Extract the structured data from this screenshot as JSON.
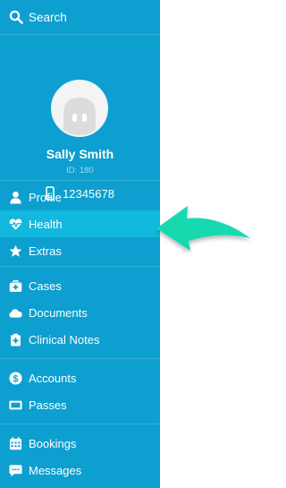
{
  "search": {
    "label": "Search",
    "icon": "search-icon"
  },
  "user": {
    "name": "Sally Smith",
    "id": "ID: 180",
    "phone": "12345678"
  },
  "nav_groups": [
    {
      "items": [
        {
          "label": "Profile",
          "icon": "user-icon"
        },
        {
          "label": "Health",
          "icon": "heartbeat-icon",
          "active": true
        },
        {
          "label": "Extras",
          "icon": "star-icon"
        }
      ]
    },
    {
      "items": [
        {
          "label": "Cases",
          "icon": "medkit-icon"
        },
        {
          "label": "Documents",
          "icon": "cloud-icon"
        },
        {
          "label": "Clinical Notes",
          "icon": "notes-icon"
        }
      ]
    },
    {
      "items": [
        {
          "label": "Accounts",
          "icon": "dollar-icon"
        },
        {
          "label": "Passes",
          "icon": "card-icon"
        }
      ]
    },
    {
      "items": [
        {
          "label": "Bookings",
          "icon": "calendar-icon"
        },
        {
          "label": "Messages",
          "icon": "chat-icon"
        }
      ]
    }
  ],
  "colors": {
    "sidebar": "#0d9fcf",
    "active_item": "#12b8de",
    "arrow": "#14d9b0"
  }
}
